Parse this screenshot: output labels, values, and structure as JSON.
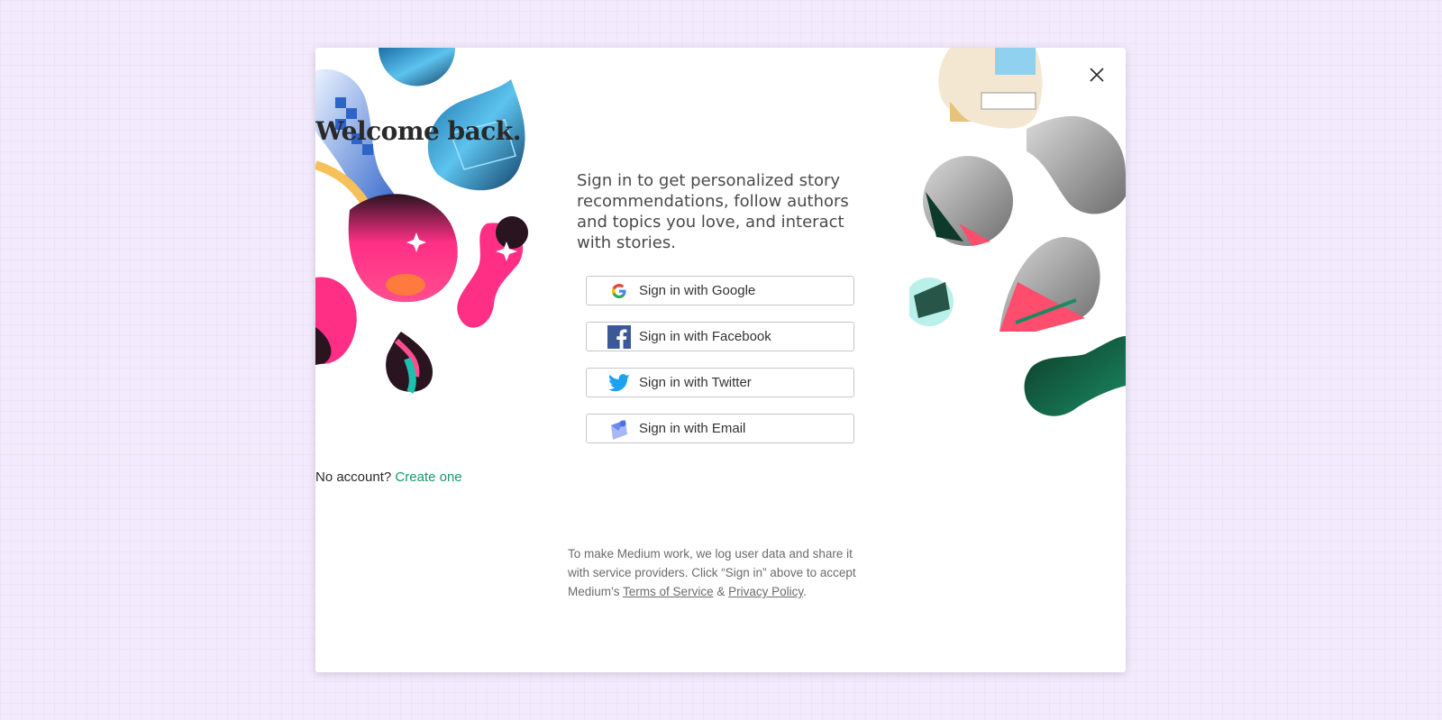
{
  "dialog": {
    "title": "Welcome back.",
    "subtitle": "Sign in to get personalized story recommendations, follow authors and topics you love, and interact with stories.",
    "close_icon": "close-icon"
  },
  "signin_buttons": [
    {
      "label": "Sign in with Google",
      "icon": "google-icon"
    },
    {
      "label": "Sign in with Facebook",
      "icon": "facebook-icon"
    },
    {
      "label": "Sign in with Twitter",
      "icon": "twitter-icon"
    },
    {
      "label": "Sign in with Email",
      "icon": "email-icon"
    }
  ],
  "no_account": {
    "text": "No account?",
    "link": "Create one"
  },
  "legal": {
    "line": "To make Medium work, we log user data and share it with service providers. Click “Sign in” above to accept Medium’s",
    "terms": "Terms of Service",
    "and": "&",
    "privacy": "Privacy Policy",
    "end": "."
  },
  "colors": {
    "background": "#f3eafc",
    "accent_link": "#0f9b6e",
    "facebook": "#3b5998",
    "twitter": "#1da1f2"
  }
}
